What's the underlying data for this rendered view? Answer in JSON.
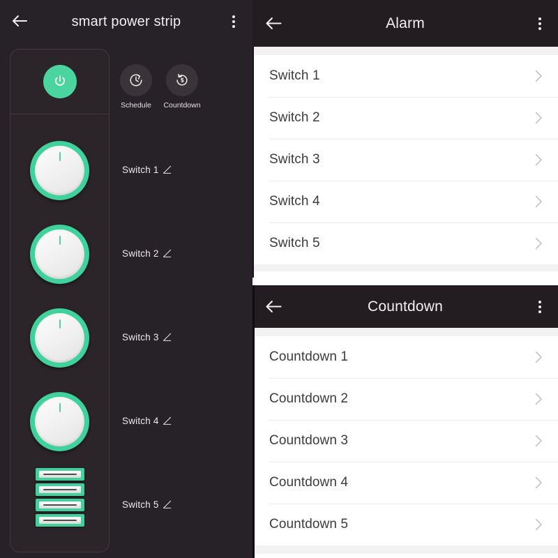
{
  "device_panel": {
    "back_icon": "arrow-left-icon",
    "title": "smart power strip",
    "menu_icon": "overflow-menu-icon",
    "power_button": {
      "icon": "power-icon",
      "state": "on",
      "color": "#4ad5a0"
    },
    "shortcuts": [
      {
        "id": "schedule",
        "icon": "schedule-clock-icon",
        "label": "Schedule"
      },
      {
        "id": "countdown",
        "icon": "countdown-timer-icon",
        "label": "Countdown"
      }
    ],
    "switches": [
      {
        "label": "Switch 1",
        "type": "knob",
        "state": "on",
        "edit_icon": "edit-pencil-icon"
      },
      {
        "label": "Switch 2",
        "type": "knob",
        "state": "on",
        "edit_icon": "edit-pencil-icon"
      },
      {
        "label": "Switch 3",
        "type": "knob",
        "state": "on",
        "edit_icon": "edit-pencil-icon"
      },
      {
        "label": "Switch 4",
        "type": "knob",
        "state": "on",
        "edit_icon": "edit-pencil-icon"
      },
      {
        "label": "Switch 5",
        "type": "usb-ports",
        "state": "on",
        "edit_icon": "edit-pencil-icon",
        "port_count": 4
      }
    ],
    "colors": {
      "background": "#272227",
      "card": "#2b2429",
      "accent_green": "#3fd29c",
      "text": "#efe9ec"
    }
  },
  "alarm_panel": {
    "back_icon": "arrow-left-icon",
    "title": "Alarm",
    "menu_icon": "overflow-menu-icon",
    "rows": [
      {
        "label": "Switch 1",
        "chevron": "chevron-right-icon"
      },
      {
        "label": "Switch 2",
        "chevron": "chevron-right-icon"
      },
      {
        "label": "Switch 3",
        "chevron": "chevron-right-icon"
      },
      {
        "label": "Switch 4",
        "chevron": "chevron-right-icon"
      },
      {
        "label": "Switch 5",
        "chevron": "chevron-right-icon"
      }
    ]
  },
  "countdown_panel": {
    "back_icon": "arrow-left-icon",
    "title": "Countdown",
    "menu_icon": "overflow-menu-icon",
    "rows": [
      {
        "label": "Countdown 1",
        "chevron": "chevron-right-icon"
      },
      {
        "label": "Countdown 2",
        "chevron": "chevron-right-icon"
      },
      {
        "label": "Countdown 3",
        "chevron": "chevron-right-icon"
      },
      {
        "label": "Countdown 4",
        "chevron": "chevron-right-icon"
      },
      {
        "label": "Countdown 5",
        "chevron": "chevron-right-icon"
      }
    ]
  }
}
